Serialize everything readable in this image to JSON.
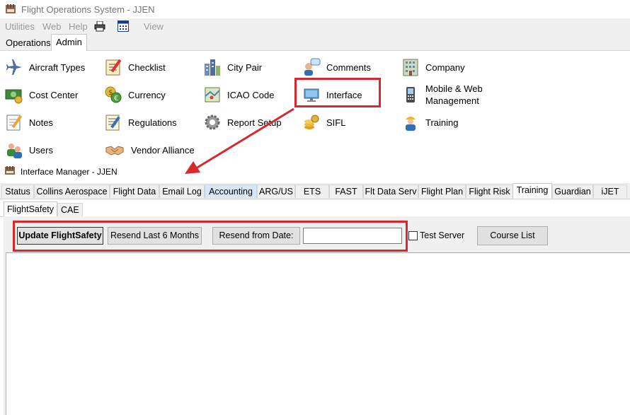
{
  "window": {
    "title": "Flight Operations System - JJEN"
  },
  "menubar": {
    "items": [
      "Utilities",
      "Web",
      "Help",
      "View"
    ],
    "icons": [
      "printer-icon",
      "calendar-icon"
    ]
  },
  "ribbon": {
    "tabs": [
      "Operations",
      "Admin"
    ],
    "active_tab": "Admin"
  },
  "admin": {
    "items": [
      {
        "label": "Aircraft Types",
        "icon": "airplane-icon"
      },
      {
        "label": "Checklist",
        "icon": "checklist-icon"
      },
      {
        "label": "City Pair",
        "icon": "city-icon"
      },
      {
        "label": "Comments",
        "icon": "comment-icon"
      },
      {
        "label": "Company",
        "icon": "building-icon"
      },
      {
        "label": "Cost Center",
        "icon": "money-icon"
      },
      {
        "label": "Currency",
        "icon": "currency-icon"
      },
      {
        "label": "ICAO Code",
        "icon": "map-icon"
      },
      {
        "label": "Interface",
        "icon": "monitor-icon"
      },
      {
        "label_line1": "Mobile & Web",
        "label_line2": "Management",
        "icon": "phone-icon"
      },
      {
        "label": "Notes",
        "icon": "notes-icon"
      },
      {
        "label": "Regulations",
        "icon": "regulations-icon"
      },
      {
        "label": "Report Setup",
        "icon": "gear-icon"
      },
      {
        "label": "SIFL",
        "icon": "coins-icon"
      },
      {
        "label": "Training",
        "icon": "worker-icon"
      },
      {
        "label": "Users",
        "icon": "users-icon"
      },
      {
        "label": "Vendor Alliance",
        "icon": "handshake-icon"
      }
    ]
  },
  "interface_manager": {
    "title": "Interface Manager - JJEN",
    "tabs": [
      "Status",
      "Collins Aerospace",
      "Flight Data",
      "Email Log",
      "Accounting",
      "ARG/US",
      "ETS",
      "FAST",
      "Flt Data Serv",
      "Flight Plan",
      "Flight Risk",
      "Training",
      "Guardian",
      "iJET"
    ],
    "active_tab": "Training",
    "hover_tab": "Accounting",
    "subtabs": [
      "FlightSafety",
      "CAE"
    ],
    "active_subtab": "FlightSafety",
    "toolbar": {
      "update_label": "Update FlightSafety",
      "resend6_label": "Resend Last 6 Months",
      "resend_date_label": "Resend from Date:",
      "date_value": "",
      "test_server_label": "Test Server",
      "test_server_checked": false,
      "course_list_label": "Course List"
    }
  },
  "colors": {
    "highlight": "#d7282c",
    "hover_tab": "#d8e6f5"
  }
}
